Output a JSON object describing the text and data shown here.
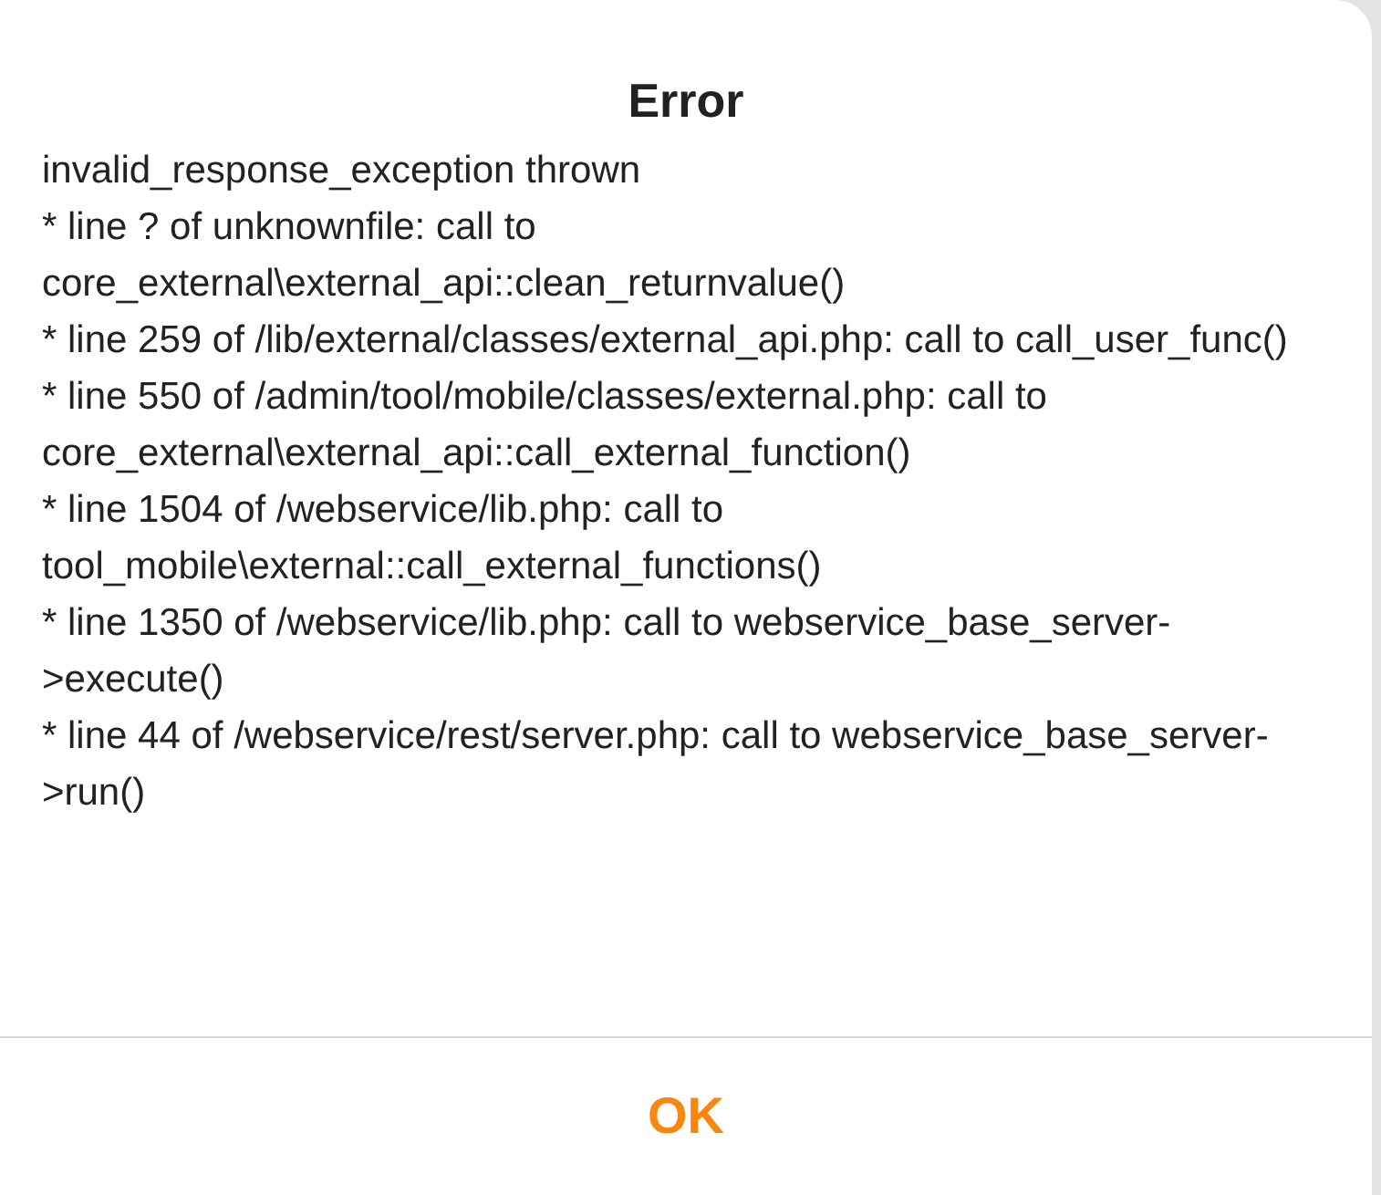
{
  "dialog": {
    "title": "Error",
    "message_lines": [
      "invalid_response_exception thrown",
      "* line ? of unknownfile: call to core_external\\external_api::clean_returnvalue()",
      "* line 259 of /lib/external/classes/external_api.php: call to call_user_func()",
      "* line 550 of /admin/tool/mobile/classes/external.php: call to core_external\\external_api::call_external_function()",
      "* line 1504 of /webservice/lib.php: call to tool_mobile\\external::call_external_functions()",
      "* line 1350 of /webservice/lib.php: call to webservice_base_server->execute()",
      "* line 44 of /webservice/rest/server.php: call to webservice_base_server->run()"
    ],
    "button": "OK"
  }
}
